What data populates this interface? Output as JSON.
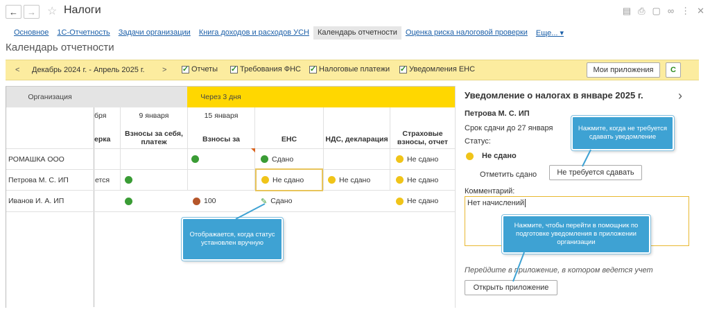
{
  "window": {
    "title": "Налоги",
    "back_icon": "←",
    "forward_icon": "→",
    "star_icon": "☆",
    "icons": [
      "save-icon",
      "print-icon",
      "preview-icon",
      "link-icon",
      "more-icon",
      "close-icon"
    ]
  },
  "tabs": [
    "Основное",
    "1С-Отчетность",
    "Задачи организации",
    "Книга доходов и расходов УСН",
    "Календарь отчетности",
    "Оценка риска налоговой проверки",
    "Еще... ▾"
  ],
  "page_title": "Календарь отчетности",
  "toolbar": {
    "prev": "<",
    "period": "Декабрь 2024 г. - Апрель 2025 г.",
    "next": ">",
    "filters": [
      "Отчеты",
      "Требования ФНС",
      "Налоговые платежи",
      "Уведомления ЕНС"
    ],
    "my_apps": "Мои приложения",
    "refresh": "C"
  },
  "grid": {
    "org_header": "Организация",
    "due_banner": "Через 3 дня",
    "dates": [
      "бря",
      "9 января",
      "15 января"
    ],
    "columns": [
      "ерка",
      "Взносы за себя, платеж",
      "Взносы за",
      "ЕНС",
      "НДС, декларация",
      "Страховые взносы, отчет"
    ],
    "rows": [
      {
        "org": "РОМАШКА ООО",
        "ens": "Сдано",
        "insurance": "Не сдано"
      },
      {
        "org": "Петрова М. С. ИП",
        "c1": "ется",
        "ens": "Не сдано",
        "vat": "Не сдано",
        "insurance": "Не сдано"
      },
      {
        "org": "Иванов И. А. ИП",
        "c3": "100",
        "ens": "Сдано",
        "insurance": "Не сдано"
      }
    ]
  },
  "panel": {
    "title": "Уведомление о налогах в январе 2025 г.",
    "arrow": "›",
    "org": "Петрова М. С. ИП",
    "deadline": "Срок сдачи до 27 января",
    "status_label": "Статус:",
    "status_value": "Не сдано",
    "mark_done": "Отметить сдано",
    "not_required_btn": "Не требуется сдавать",
    "comment_label": "Комментарий:",
    "comment_value": "Нет начислений",
    "hint": "Перейдите в приложение, в котором ведется учет",
    "open_app_btn": "Открыть приложение"
  },
  "callouts": {
    "manual": "Отображается, когда статус установлен вручную",
    "not_required": "Нажмите, когда не требуется сдавать уведомление",
    "open_app": "Нажмите, чтобы перейти в помощник по подготовке уведомления в приложении организации"
  },
  "colors": {
    "toolbar_bg": "#fcec9f",
    "due_banner": "#ffd700",
    "status_yellow": "#f0c419",
    "status_green": "#3a9c35",
    "accent_orange": "#e8a100",
    "callout": "#3ea2d3"
  }
}
